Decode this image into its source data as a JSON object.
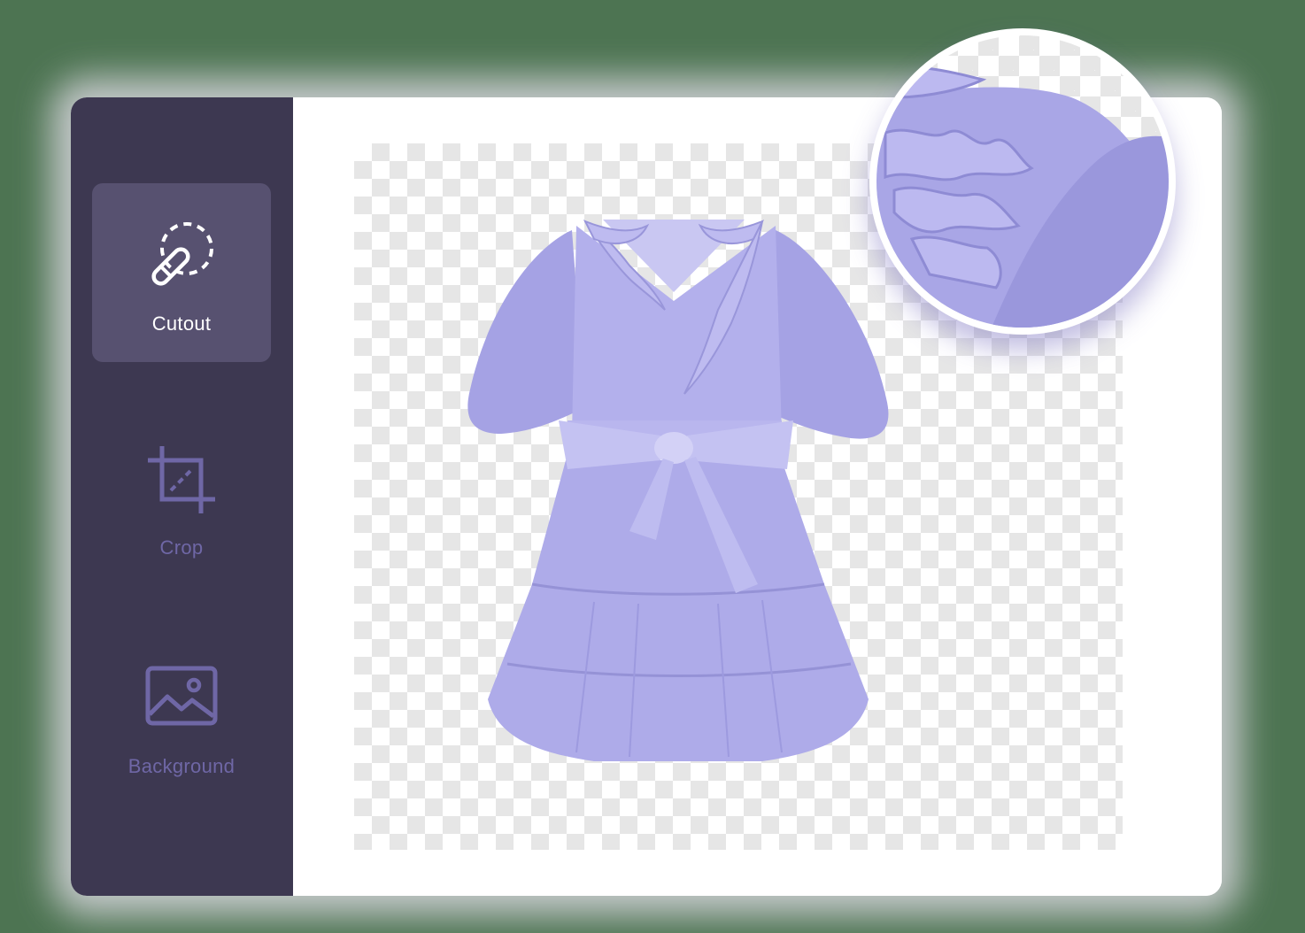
{
  "sidebar": {
    "tools": [
      {
        "label": "Cutout",
        "icon": "cutout-icon",
        "active": true
      },
      {
        "label": "Crop",
        "icon": "crop-icon",
        "active": false
      },
      {
        "label": "Background",
        "icon": "image-icon",
        "active": false
      }
    ]
  },
  "colors": {
    "sidebar_bg": "#3d3851",
    "active_tool_bg": "#575170",
    "inactive_tool_color": "#6f67a6",
    "dress": "#a9a6e6"
  }
}
